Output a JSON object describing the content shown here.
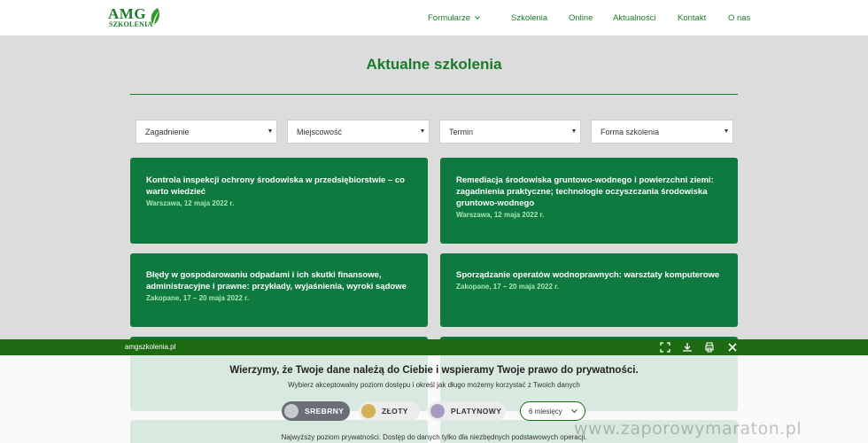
{
  "logo": {
    "brand": "AMG",
    "sub": "SZKOLENIA"
  },
  "nav": [
    {
      "label": "Formularze",
      "has_dropdown": true
    },
    {
      "label": "Szkolenia"
    },
    {
      "label": "Online"
    },
    {
      "label": "Aktualności"
    },
    {
      "label": "Kontakt"
    },
    {
      "label": "O nas"
    }
  ],
  "page": {
    "title": "Aktualne szkolenia"
  },
  "filters": [
    {
      "label": "Zagadnienie"
    },
    {
      "label": "Miejscowość"
    },
    {
      "label": "Termin"
    },
    {
      "label": "Forma szkolenia"
    }
  ],
  "cards": [
    {
      "title": "Kontrola inspekcji ochrony środowiska w przedsiębiorstwie – co warto wiedzieć",
      "meta": "Warszawa, 12 maja 2022 r."
    },
    {
      "title": "Remediacja środowiska gruntowo-wodnego i powierzchni ziemi: zagadnienia praktyczne; technologie oczyszczania środowiska gruntowo-wodnego",
      "meta": "Warszawa, 12 maja 2022 r."
    },
    {
      "title": "Błędy w gospodarowaniu odpadami i ich skutki finansowe, administracyjne i prawne: przykłady, wyjaśnienia, wyroki sądowe",
      "meta": "Zakopane, 17 – 20 maja 2022 r."
    },
    {
      "title": "Sporządzanie operatów wodnoprawnych: warsztaty komputerowe",
      "meta": "Zakopane, 17 – 20 maja 2022 r."
    }
  ],
  "cookie": {
    "domain": "amgszkolenia.pl",
    "heading": "Wierzymy, że Twoje dane należą do Ciebie i wspieramy Twoje prawo do prywatności.",
    "subheading": "Wybierz akceptowalny poziom dostępu i określ jak długo możemy korzystać z Twoich danych",
    "levels": [
      {
        "label": "SREBRNY",
        "color": "#c7c9cc",
        "selected": true
      },
      {
        "label": "ZŁOTY",
        "color": "#d4b25a",
        "selected": false
      },
      {
        "label": "PLATYNOWY",
        "color": "#a99ac0",
        "selected": false
      }
    ],
    "duration": "6 miesięcy",
    "bottom_text": "Najwyższy poziom prywatności. Dostęp do danych tylko dla niezbędnych podstawowych operacji.",
    "icons": [
      "fullscreen-icon",
      "download-icon",
      "print-icon",
      "close-icon"
    ]
  },
  "watermark": "www.zaporowymaraton.pl",
  "colors": {
    "brand_green": "#1a7a2a",
    "card_green": "#0e7a3f",
    "bar_green": "#1d6a12"
  }
}
